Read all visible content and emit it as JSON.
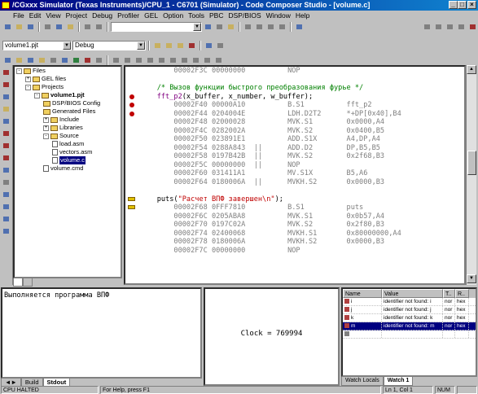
{
  "window": {
    "title": "/CGxxx Simulator (Texas Instruments)/CPU_1 - C6701 (Simulator) - Code Composer Studio - [volume.c]"
  },
  "menu": [
    "File",
    "Edit",
    "View",
    "Project",
    "Debug",
    "Profiler",
    "GEL",
    "Option",
    "Tools",
    "PBC",
    "DSP/BIOS",
    "Window",
    "Help"
  ],
  "toolbar": {
    "project_combo": "volume1.pjt",
    "config_combo": "Debug"
  },
  "tree": [
    {
      "label": "Files",
      "indent": 0,
      "kind": "folder",
      "pm": "-"
    },
    {
      "label": "GEL files",
      "indent": 1,
      "kind": "folder",
      "pm": "+"
    },
    {
      "label": "Projects",
      "indent": 1,
      "kind": "folder",
      "pm": "-"
    },
    {
      "label": "volume1.pjt",
      "indent": 2,
      "kind": "folder",
      "pm": "-",
      "bold": true
    },
    {
      "label": "DSP/BIOS Config",
      "indent": 3,
      "kind": "folder",
      "pm": ""
    },
    {
      "label": "Generated Files",
      "indent": 3,
      "kind": "folder",
      "pm": ""
    },
    {
      "label": "Include",
      "indent": 3,
      "kind": "folder",
      "pm": "+"
    },
    {
      "label": "Libraries",
      "indent": 3,
      "kind": "folder",
      "pm": "+"
    },
    {
      "label": "Source",
      "indent": 3,
      "kind": "folder",
      "pm": "-"
    },
    {
      "label": "load.asm",
      "indent": 4,
      "kind": "doc",
      "pm": ""
    },
    {
      "label": "vectors.asm",
      "indent": 4,
      "kind": "doc",
      "pm": ""
    },
    {
      "label": "volume.c",
      "indent": 4,
      "kind": "doc",
      "pm": "",
      "selected": true
    },
    {
      "label": "volume.cmd",
      "indent": 3,
      "kind": "doc",
      "pm": ""
    }
  ],
  "code": [
    {
      "t": "asm",
      "s": "        00002F3C 00000000          NOP"
    },
    {
      "t": "blank",
      "s": ""
    },
    {
      "t": "cmt",
      "s": "    /* Вызов функции быстрого преобразования фурье */"
    },
    {
      "t": "fncall",
      "s": "    fft_p2",
      "rest": "(x_buffer, x_number, w_buffer);"
    },
    {
      "t": "asm",
      "s": "        00002F40 00000A10          B.S1          fft_p2"
    },
    {
      "t": "asm",
      "s": "        00002F44 0204004E          LDH.D2T2      *+DP[0x40],B4"
    },
    {
      "t": "asm",
      "s": "        00002F48 02000028          MVK.S1        0x0000,A4"
    },
    {
      "t": "asm",
      "s": "        00002F4C 0282002A          MVK.S2        0x0400,B5"
    },
    {
      "t": "asm",
      "s": "        00002F50 023891E1          ADD.S1X       A4,DP,A4"
    },
    {
      "t": "asm",
      "s": "        00002F54 0288A843  ||      ADD.D2        DP,B5,B5"
    },
    {
      "t": "asm",
      "s": "        00002F58 0197B42B  ||      MVK.S2        0x2f68,B3"
    },
    {
      "t": "asm",
      "s": "        00002F5C 00000000  ||      NOP"
    },
    {
      "t": "asm",
      "s": "        00002F60 031411A1          MV.S1X        B5,A6"
    },
    {
      "t": "asm",
      "s": "        00002F64 0180006A  ||      MVKH.S2       0x0000,B3"
    },
    {
      "t": "blank",
      "s": ""
    },
    {
      "t": "puts",
      "s": "    puts(",
      "str": "\"Расчет ВПФ завершен\\n\"",
      "rest": ");"
    },
    {
      "t": "asm",
      "s": "        00002F68 0FFF7810          B.S1          puts"
    },
    {
      "t": "asm",
      "s": "        00002F6C 0205ABA8          MVK.S1        0x0b57,A4"
    },
    {
      "t": "asm",
      "s": "        00002F70 0197C02A          MVK.S2        0x2f80,B3"
    },
    {
      "t": "asm",
      "s": "        00002F74 02400068          MVKH.S1       0x80000000,A4"
    },
    {
      "t": "asm",
      "s": "        00002F78 0180006A          MVKH.S2       0x0000,B3"
    },
    {
      "t": "asm",
      "s": "        00002F7C 00000000          NOP"
    }
  ],
  "stdout": {
    "text": "Выполняется программа ВПФ"
  },
  "output_tabs": [
    "Build",
    "Stdout"
  ],
  "clock": {
    "text": "Clock = 769994"
  },
  "watch": {
    "headers": [
      "Name",
      "Value",
      "T..",
      "R.."
    ],
    "rows": [
      {
        "name": "i",
        "value": "identifier not found: i",
        "t": "nor",
        "r": "hex"
      },
      {
        "name": "j",
        "value": "identifier not found: j",
        "t": "nor",
        "r": "hex"
      },
      {
        "name": "k",
        "value": "identifier not found: k",
        "t": "nor",
        "r": "hex"
      },
      {
        "name": "m",
        "value": "identifier not found: m",
        "t": "nor",
        "r": "hex",
        "selected": true
      }
    ],
    "tabs": [
      "Watch Locals",
      "Watch 1"
    ]
  },
  "status": {
    "cpu": "CPU HALTED",
    "help": "For Help, press F1",
    "pos": "Ln 1, Col 1",
    "num": "NUM"
  }
}
